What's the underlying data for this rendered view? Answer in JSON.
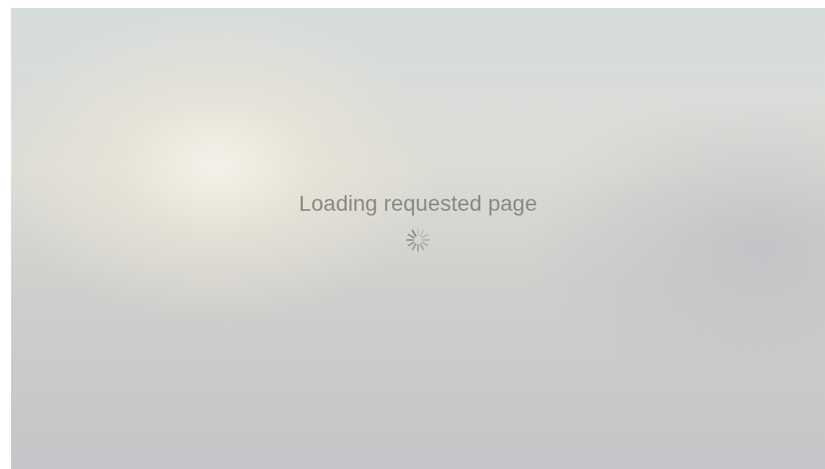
{
  "loading": {
    "message": "Loading requested page"
  }
}
